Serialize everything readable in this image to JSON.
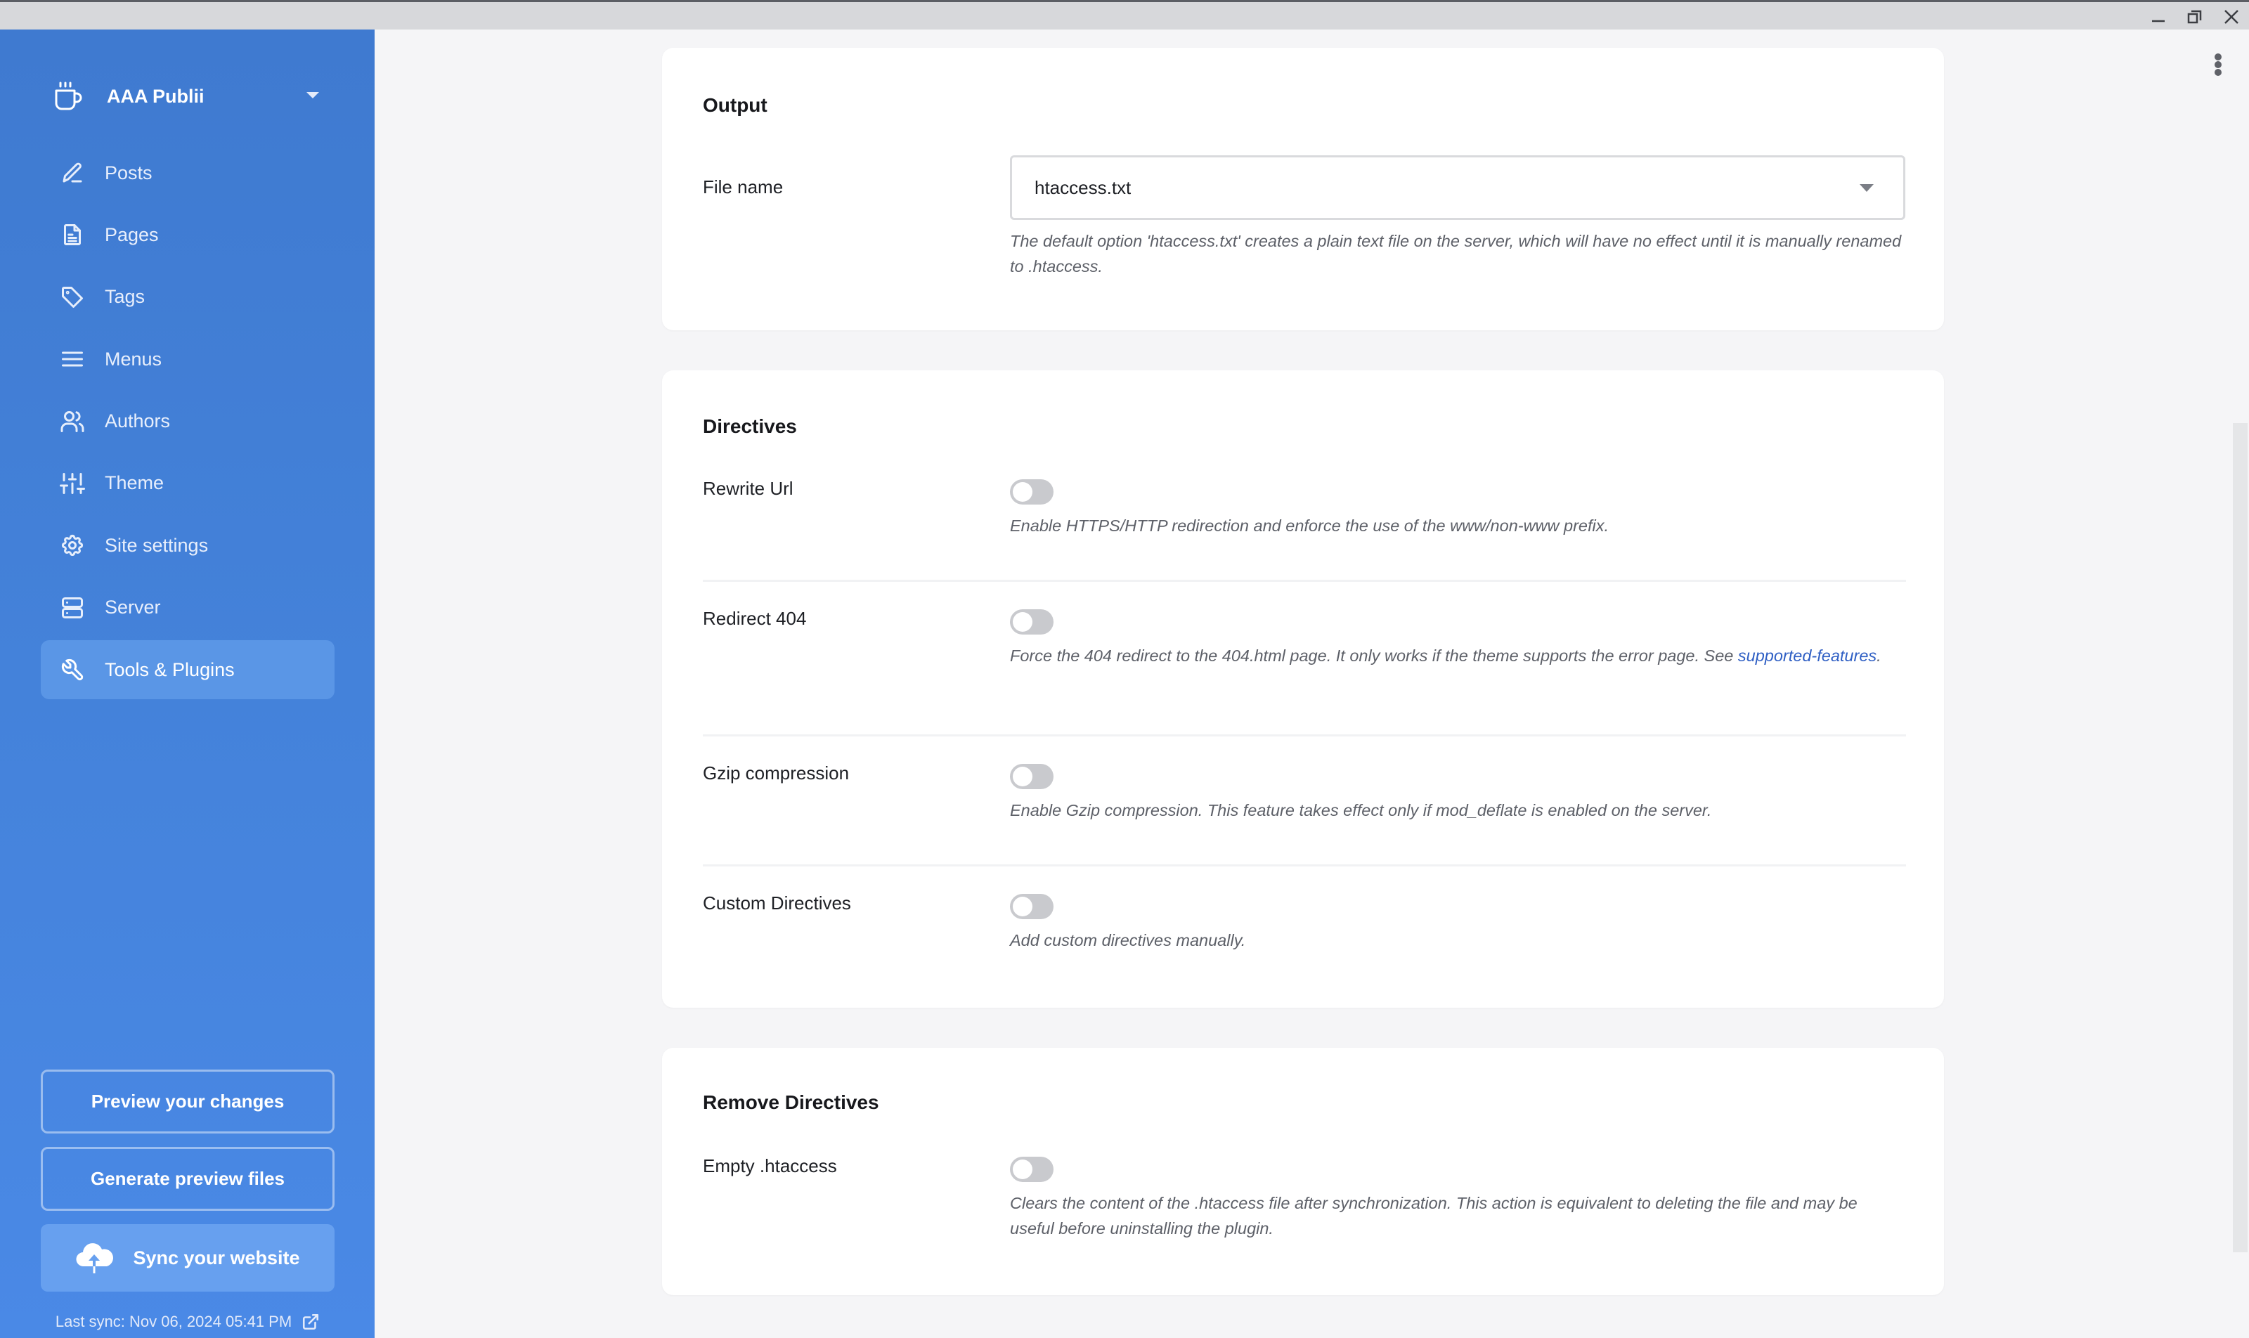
{
  "window": {
    "controls": [
      "minimize",
      "restore",
      "close"
    ]
  },
  "sidebar": {
    "site_name": "AAA Publii",
    "site_icon": "coffee-cup-icon",
    "items": [
      {
        "label": "Posts",
        "icon": "pencil-icon",
        "active": false
      },
      {
        "label": "Pages",
        "icon": "document-icon",
        "active": false
      },
      {
        "label": "Tags",
        "icon": "tag-icon",
        "active": false
      },
      {
        "label": "Menus",
        "icon": "hamburger-menu-icon",
        "active": false
      },
      {
        "label": "Authors",
        "icon": "users-icon",
        "active": false
      },
      {
        "label": "Theme",
        "icon": "sliders-icon",
        "active": false
      },
      {
        "label": "Site settings",
        "icon": "gear-icon",
        "active": false
      },
      {
        "label": "Server",
        "icon": "server-icon",
        "active": false
      },
      {
        "label": "Tools & Plugins",
        "icon": "wrench-icon",
        "active": true
      }
    ],
    "preview_button": "Preview your changes",
    "generate_button": "Generate preview files",
    "sync_button": "Sync your website",
    "last_sync": "Last sync: Nov 06, 2024 05:41 PM"
  },
  "colors": {
    "sidebar_top": "#3f7ad0",
    "sidebar_bottom": "#4a89e6",
    "active_item": "#5a96e6",
    "sync_button": "#67a0ef",
    "link": "#2f5fc4",
    "toggle_off": "#c9cace"
  },
  "sections": {
    "output": {
      "title": "Output",
      "file_name": {
        "label": "File name",
        "value": "htaccess.txt",
        "help": "The default option 'htaccess.txt' creates a plain text file on the server, which will have no effect until it is manually renamed to .htaccess."
      }
    },
    "directives": {
      "title": "Directives",
      "rows": [
        {
          "label": "Rewrite Url",
          "enabled": false,
          "help": "Enable HTTPS/HTTP redirection and enforce the use of the www/non-www prefix."
        },
        {
          "label": "Redirect 404",
          "enabled": false,
          "help": "Force the 404 redirect to the 404.html page. It only works if the theme supports the error page. See ",
          "link": "supported-features",
          "help_after": "."
        },
        {
          "label": "Gzip compression",
          "enabled": false,
          "help": "Enable Gzip compression. This feature takes effect only if mod_deflate is enabled on the server."
        },
        {
          "label": "Custom Directives",
          "enabled": false,
          "help": "Add custom directives manually."
        }
      ]
    },
    "remove": {
      "title": "Remove Directives",
      "rows": [
        {
          "label": "Empty .htaccess",
          "enabled": false,
          "help": "Clears the content of the .htaccess file after synchronization. This action is equivalent to deleting the file and may be useful before uninstalling the plugin."
        }
      ]
    }
  }
}
